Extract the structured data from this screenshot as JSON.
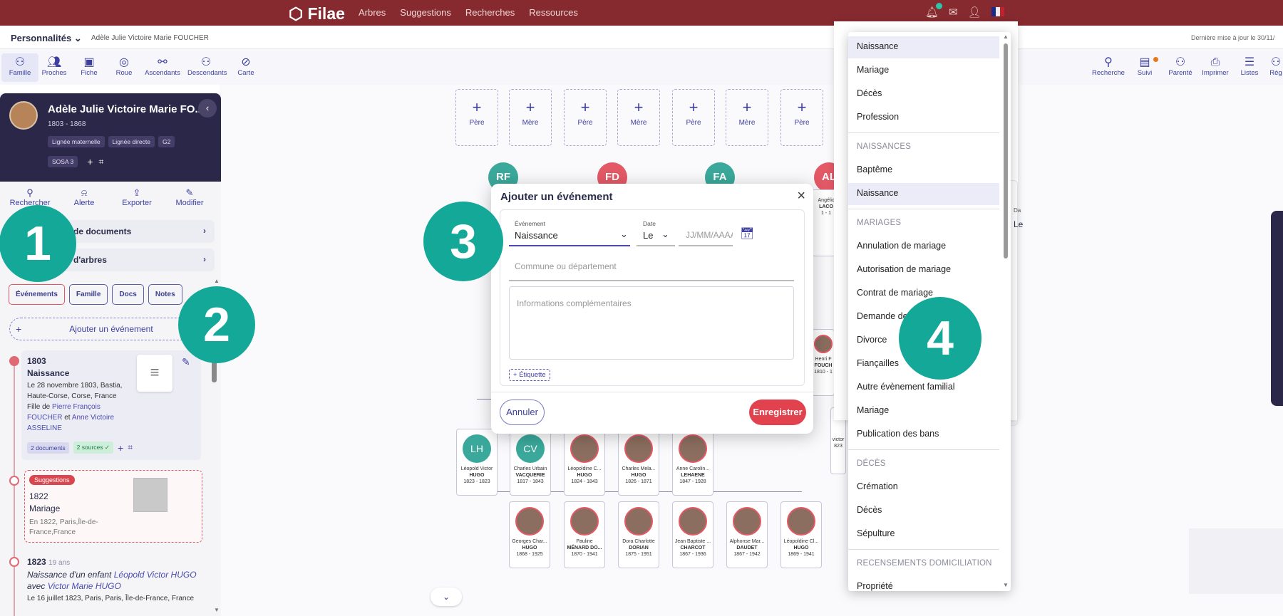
{
  "topbar": {
    "logo": "Filae",
    "nav": [
      "Arbres",
      "Suggestions",
      "Recherches",
      "Ressources"
    ]
  },
  "subbar": {
    "section": "Personnalités",
    "person": "Adèle Julie Victoire Marie FOUCHER",
    "updated": "Dernière mise à jour le 30/11/"
  },
  "toolbar_left": [
    "Famille",
    "Proches",
    "Fiche",
    "Roue",
    "Ascendants",
    "Descendants",
    "Carte"
  ],
  "toolbar_right": [
    "Recherche",
    "Suivi",
    "Parenté",
    "Imprimer",
    "Listes",
    "Rég"
  ],
  "profile": {
    "name": "Adèle Julie Victoire Marie FO...",
    "years": "1803 - 1868",
    "chips": [
      "Lignée maternelle",
      "Lignée directe",
      "G2"
    ],
    "sosa": "SOSA 3"
  },
  "actions": [
    "Rechercher",
    "Alerte",
    "Exporter",
    "Modifier"
  ],
  "sections": [
    "de documents",
    "d'arbres"
  ],
  "tabs": [
    "Événements",
    "Famille",
    "Docs",
    "Notes"
  ],
  "add_event": "Ajouter un événement",
  "event1": {
    "year": "1803",
    "title": "Naissance",
    "line1": "Le 28 novembre 1803, Bastia, Haute-Corse, Corse, France",
    "filiation": "Fille de",
    "father": "Pierre François FOUCHER",
    "and": "et",
    "mother": "Anne Victoire ASSELINE",
    "docs": "2 documents",
    "sources": "2 sources ✓"
  },
  "suggestion": {
    "tag": "Suggestions",
    "year": "1822",
    "title": "Mariage",
    "place": "En 1822, Paris,Île-de-France,France"
  },
  "event3": {
    "year": "1823",
    "age": "19 ans",
    "title_a": "Naissance d'un enfant ",
    "child": "Léopold Victor HUGO",
    "title_b": " avec ",
    "spouse": "Victor Marie HUGO",
    "place": "Le 16 juillet 1823, Paris, Paris, Île-de-France, France"
  },
  "tree": {
    "parents": [
      "Père",
      "Mère",
      "Père",
      "Mère",
      "Père",
      "Mère",
      "Père"
    ],
    "initials": [
      "RF",
      "FD",
      "FA",
      "AL"
    ],
    "children": [
      {
        "init": "LH",
        "name": "Léopold Victor",
        "surname": "HUGO",
        "years": "1823 - 1823"
      },
      {
        "init": "CV",
        "name": "Charles Urbain",
        "surname": "VACQUERIE",
        "years": "1817 - 1843"
      },
      {
        "init": "",
        "name": "Léopoldine C...",
        "surname": "HUGO",
        "years": "1824 - 1843"
      },
      {
        "init": "",
        "name": "Charles Mela...",
        "surname": "HUGO",
        "years": "1826 - 1871"
      },
      {
        "init": "",
        "name": "Anne Carolin...",
        "surname": "LEHAENE",
        "years": "1847 - 1928"
      }
    ],
    "grandchildren": [
      {
        "name": "Georges Char...",
        "surname": "HUGO",
        "years": "1868 - 1925"
      },
      {
        "name": "Pauline",
        "surname": "MÉNARD DO...",
        "years": "1870 - 1941"
      },
      {
        "name": "Dora Charlotte",
        "surname": "DORIAN",
        "years": "1875 - 1951"
      },
      {
        "name": "Jean Baptiste ...",
        "surname": "CHARCOT",
        "years": "1867 - 1936"
      },
      {
        "name": "Alphonse Mar...",
        "surname": "DAUDET",
        "years": "1867 - 1942"
      },
      {
        "name": "Léopoldine Cl...",
        "surname": "HUGO",
        "years": "1869 - 1941"
      }
    ],
    "partial_cards": [
      {
        "name": "Angélic",
        "surname": "LACO",
        "years": "1 - 1"
      },
      {
        "name": "Henri F",
        "surname": "FOUCH",
        "years": "1810 - 1"
      },
      {
        "name": "victor",
        "surname": "",
        "years": "823"
      }
    ]
  },
  "modal": {
    "title": "Ajouter un événement",
    "event_label": "Événement",
    "event_value": "Naissance",
    "date_label": "Date",
    "date_mode": "Le",
    "date_placeholder": "JJ/MM/AAAA",
    "place_placeholder": "Commune ou département",
    "info_placeholder": "Informations complémentaires",
    "tag_label": "Étiquette",
    "cancel": "Annuler",
    "save": "Enregistrer"
  },
  "behind_panel": {
    "label": "Da",
    "value": "Le"
  },
  "dropdown": {
    "items": [
      {
        "type": "item",
        "label": "Naissance",
        "hl": true
      },
      {
        "type": "item",
        "label": "Mariage"
      },
      {
        "type": "item",
        "label": "Décès"
      },
      {
        "type": "item",
        "label": "Profession"
      },
      {
        "type": "sep"
      },
      {
        "type": "head",
        "label": "NAISSANCES"
      },
      {
        "type": "item",
        "label": "Baptême"
      },
      {
        "type": "item",
        "label": "Naissance",
        "hl": true
      },
      {
        "type": "sep"
      },
      {
        "type": "head",
        "label": "MARIAGES"
      },
      {
        "type": "item",
        "label": "Annulation de mariage"
      },
      {
        "type": "item",
        "label": "Autorisation de mariage"
      },
      {
        "type": "item",
        "label": "Contrat de mariage"
      },
      {
        "type": "item",
        "label": "Demande de"
      },
      {
        "type": "item",
        "label": "Divorce"
      },
      {
        "type": "item",
        "label": "Fiançailles"
      },
      {
        "type": "item",
        "label": "Autre évènement familial"
      },
      {
        "type": "item",
        "label": "Mariage"
      },
      {
        "type": "item",
        "label": "Publication des bans"
      },
      {
        "type": "sep"
      },
      {
        "type": "head",
        "label": "DÉCÈS"
      },
      {
        "type": "item",
        "label": "Crémation"
      },
      {
        "type": "item",
        "label": "Décès"
      },
      {
        "type": "item",
        "label": "Sépulture"
      },
      {
        "type": "sep"
      },
      {
        "type": "head",
        "label": "RECENSEMENTS DOMICILIATION"
      },
      {
        "type": "item",
        "label": "Propriété"
      }
    ]
  },
  "callouts": [
    "1",
    "2",
    "3",
    "4"
  ],
  "colors": {
    "topbar": "#862a2f",
    "accent": "#14a898",
    "primary": "#3d3f9e",
    "danger": "#e2424d",
    "profile_bg": "#2b2748"
  }
}
